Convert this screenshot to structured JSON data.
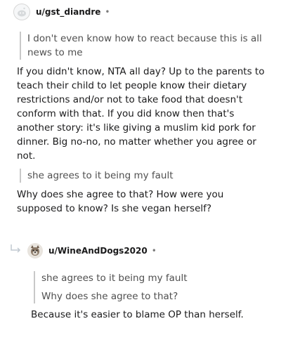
{
  "comment1": {
    "username": "u/gst_diandre",
    "separator": "•",
    "quote": "I don't even know how to react because this is all news to me",
    "body": "If you didn't know, NTA all day? Up to the parents to teach their child to let people know their dietary restrictions and/or not to take food that doesn't conform with that. If you did know then that's another story: it's like giving a muslim kid pork for dinner. Big no-no, no matter whether you agree or not.",
    "quote2": "she agrees to it being my fault",
    "body2": "Why does she agree to that? How were you supposed to know? Is she vegan herself?"
  },
  "comment2": {
    "username": "u/WineAndDogs2020",
    "separator": "•",
    "quote_line1": "she agrees to it being my fault",
    "quote_line2": "Why does she agree to that?",
    "body": "Because it's easier to blame OP than herself."
  },
  "icons": {
    "avatar1": "default-snoo-avatar-icon",
    "avatar2": "dog-avatar-icon",
    "reply": "reply-arrow-icon"
  },
  "colors": {
    "quote_bar": "#c8c8c8",
    "reply_arrow": "#c0c8d0"
  }
}
